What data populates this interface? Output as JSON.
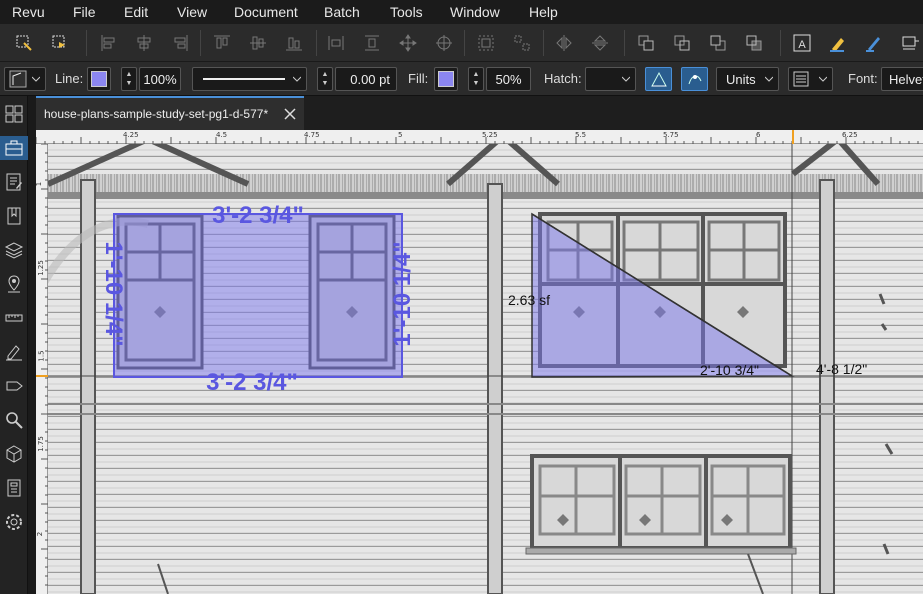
{
  "menu": [
    "Revu",
    "File",
    "Edit",
    "View",
    "Document",
    "Batch",
    "Tools",
    "Window",
    "Help"
  ],
  "properties": {
    "line_label": "Line:",
    "line_opacity": "100%",
    "line_width": "0.00 pt",
    "fill_label": "Fill:",
    "fill_opacity": "50%",
    "hatch_label": "Hatch:",
    "units_label": "Units",
    "font_label": "Font:",
    "font_value": "Helvet",
    "fill_color": "#8b86f0"
  },
  "tab": {
    "title": "house-plans-sample-study-set-pg1-d-577*"
  },
  "ruler": {
    "top_ticks": [
      "4.25",
      "4.5",
      "4.75",
      "5",
      "5.25",
      "5.5",
      "5.75",
      "6",
      "6.25"
    ],
    "left_ticks": [
      "1",
      "1.25",
      "1.5",
      "1.75",
      "2"
    ]
  },
  "markups": {
    "dim_top": "3'-2 3/4\"",
    "dim_bottom": "3'-2 3/4\"",
    "dim_left": "1'-10 1/4\"",
    "dim_right": "1'-10 1/4\"",
    "area": "2.63 sf",
    "hyp_length": "2'-10 3/4\"",
    "dist_length": "4'-8 1/2\""
  },
  "colors": {
    "markup_fill": "#7b78ee",
    "markup_text": "#5a57e0",
    "accent": "#2a5d8f"
  }
}
